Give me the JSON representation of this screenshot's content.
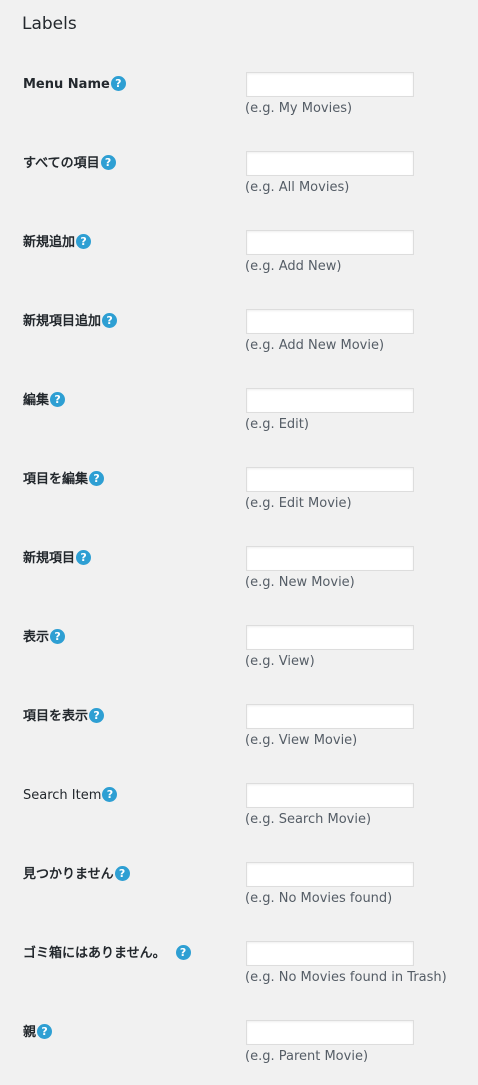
{
  "section": {
    "title": "Labels"
  },
  "help_icon": {
    "name": "question-circle-icon",
    "glyph": "?"
  },
  "rows": [
    {
      "label": "Menu Name",
      "value": "",
      "hint": "(e.g. My Movies)"
    },
    {
      "label": "すべての項目",
      "value": "",
      "hint": "(e.g. All Movies)"
    },
    {
      "label": "新規追加",
      "value": "",
      "hint": "(e.g. Add New)"
    },
    {
      "label": "新規項目追加",
      "value": "",
      "hint": "(e.g. Add New Movie)"
    },
    {
      "label": "編集",
      "value": "",
      "hint": "(e.g. Edit)"
    },
    {
      "label": "項目を編集",
      "value": "",
      "hint": "(e.g. Edit Movie)"
    },
    {
      "label": "新規項目",
      "value": "",
      "hint": "(e.g. New Movie)"
    },
    {
      "label": "表示",
      "value": "",
      "hint": "(e.g. View)"
    },
    {
      "label": "項目を表示",
      "value": "",
      "hint": "(e.g. View Movie)"
    },
    {
      "label": "Search Item",
      "value": "",
      "hint": "(e.g. Search Movie)"
    },
    {
      "label": "見つかりません",
      "value": "",
      "hint": "(e.g. No Movies found)"
    },
    {
      "label": "ゴミ箱にはありません。",
      "value": "",
      "hint": "(e.g. No Movies found in Trash)"
    },
    {
      "label": "親",
      "value": "",
      "hint": "(e.g. Parent Movie)"
    }
  ],
  "colors": {
    "background": "#f1f1f1",
    "help_icon": "#2e9fd3",
    "input_border": "#dddddd",
    "hint_text": "#555d66"
  }
}
